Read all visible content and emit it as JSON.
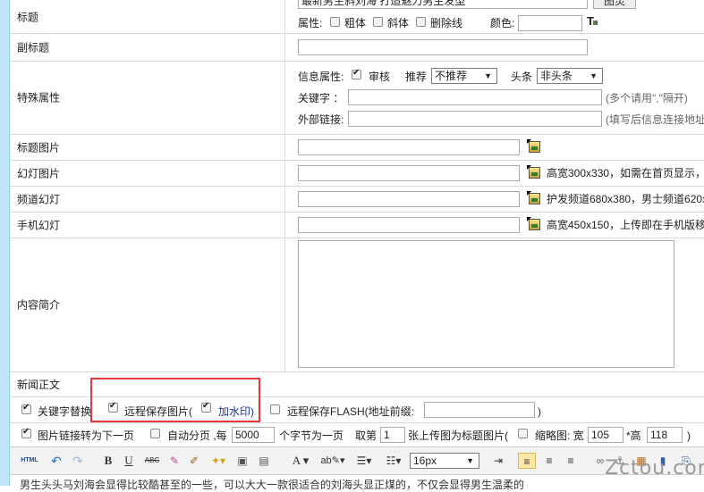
{
  "title_row": {
    "label": "标题",
    "value": "最新男生斜刘海 打造魅力男生发型",
    "button": "图灵",
    "attr_label": "属性:",
    "bold": "粗体",
    "italic": "斜体",
    "strike": "删除线",
    "color_label": "颜色:"
  },
  "subtitle_row": {
    "label": "副标题"
  },
  "special_row": {
    "label": "特殊属性",
    "info_attr": "信息属性:",
    "audit": "审核",
    "recommend": "推荐",
    "recommend_val": "不推荐",
    "headline": "头条",
    "headline_val": "非头条",
    "keyword_label": "关键字  ：",
    "keyword_hint": "(多个请用\",\"隔开)",
    "link_label": "外部链接:",
    "link_hint": "(填写后信息连接地址将"
  },
  "title_image_row": {
    "label": "标题图片"
  },
  "slide_row": {
    "label": "幻灯图片",
    "hint": "高宽300x330，如需在首页显示，这"
  },
  "channel_row": {
    "label": "频道幻灯",
    "hint": "护发频道680x380，男士频道620x4"
  },
  "mobile_row": {
    "label": "手机幻灯",
    "hint": "高宽450x150，上传即在手机版移动"
  },
  "intro_row": {
    "label": "内容简介"
  },
  "news_row": {
    "label": "新闻正文"
  },
  "options1": {
    "keyword_replace": "关键字替换",
    "remote_save": "远程保存图片(",
    "watermark": "加水印)",
    "remote_flash": "远程保存FLASH(地址前缀:",
    "close_paren": ")"
  },
  "options2": {
    "link_next": "图片链接转为下一页",
    "auto_page": "自动分页 ,每",
    "chars": "5000",
    "chars_unit": "个字节为一页",
    "take": "取第",
    "take_num": "1",
    "as_title": "张上传图为标题图片(",
    "thumb": "缩略图: 宽",
    "width": "105",
    "height_label": "*高",
    "height": "118",
    "close": ")"
  },
  "toolbar": {
    "html": "HTML",
    "bold": "B",
    "underline": "U",
    "strike": "ABC",
    "font": "A",
    "size": "16px"
  },
  "bottom_text": "男生头头马刘海会显得比较酷甚至的一些，可以大大一款很适合的刘海头显正煤的，不仅会显得男生温柔的",
  "watermark": "Zctou.com"
}
